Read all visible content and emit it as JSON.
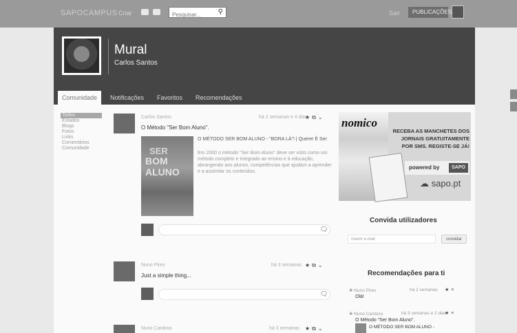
{
  "topbar": {
    "logo": "SAPOCAMPUS",
    "link": "Criar",
    "search_placeholder": "Pesquisar...",
    "right_link": "Sair",
    "user_label": "PUBLICAÇÕES"
  },
  "profile": {
    "title": "Mural",
    "name": "Carlos Santos"
  },
  "tabs": [
    {
      "label": "Comunidade"
    },
    {
      "label": "Notificações"
    },
    {
      "label": "Favoritos"
    },
    {
      "label": "Recomendações"
    }
  ],
  "leftnav": [
    "Todos",
    "Estados",
    "Blogs",
    "Fotos",
    "Links",
    "Comentários",
    "Comunidade"
  ],
  "posts": [
    {
      "author": "Carlos Santos",
      "time": "há 2 semanas e 4 dias",
      "text": "O Método \"Ser Bom Aluno\".",
      "media": {
        "image_line1": "SER",
        "image_line2": "BOM ALUNO",
        "title": "O MÉTODO SER BOM ALUNO - \"BORA LÁ\"! | Querer É Ser",
        "desc": "Em 2000 o método \"Ser Bom Aluno\" deve ser visto como um método completo e integrado ao ensino e à educação, abrangendo aos alunos, competências que ajudam a aprender e a assimilar os conteúdos."
      }
    },
    {
      "author": "Nuno Pires",
      "time": "há 3 semanas",
      "text": "Just a simple thing..."
    },
    {
      "author": "Nuno Cardoso",
      "time": "há 3 semanas"
    }
  ],
  "ad": {
    "paper_title": "nomico",
    "text_line1": "RECEBA AS MANCHETES DOS",
    "text_line2": "JORNAIS GRATUITAMENTE",
    "text_line3": "POR SMS. REGISTE-SE JÁ!",
    "powered_by": "powered by",
    "powered_logo": "SAPO",
    "sapo": "sapo.pt"
  },
  "invite": {
    "title": "Convida utilizadores",
    "placeholder": "Inserir e-mail",
    "button": "convidar"
  },
  "recommendations": {
    "title": "Recomendações para ti",
    "items": [
      {
        "author": "Nuno Pires",
        "time": "há 2 semanas",
        "text": "Olá!"
      },
      {
        "author": "Nuno Cardoso",
        "time": "há 3 semanas e 2 dias",
        "text": "O Método \"Ser Bom Aluno\".",
        "sub": "O MÉTODO SER BOM ALUNO -"
      }
    ]
  }
}
